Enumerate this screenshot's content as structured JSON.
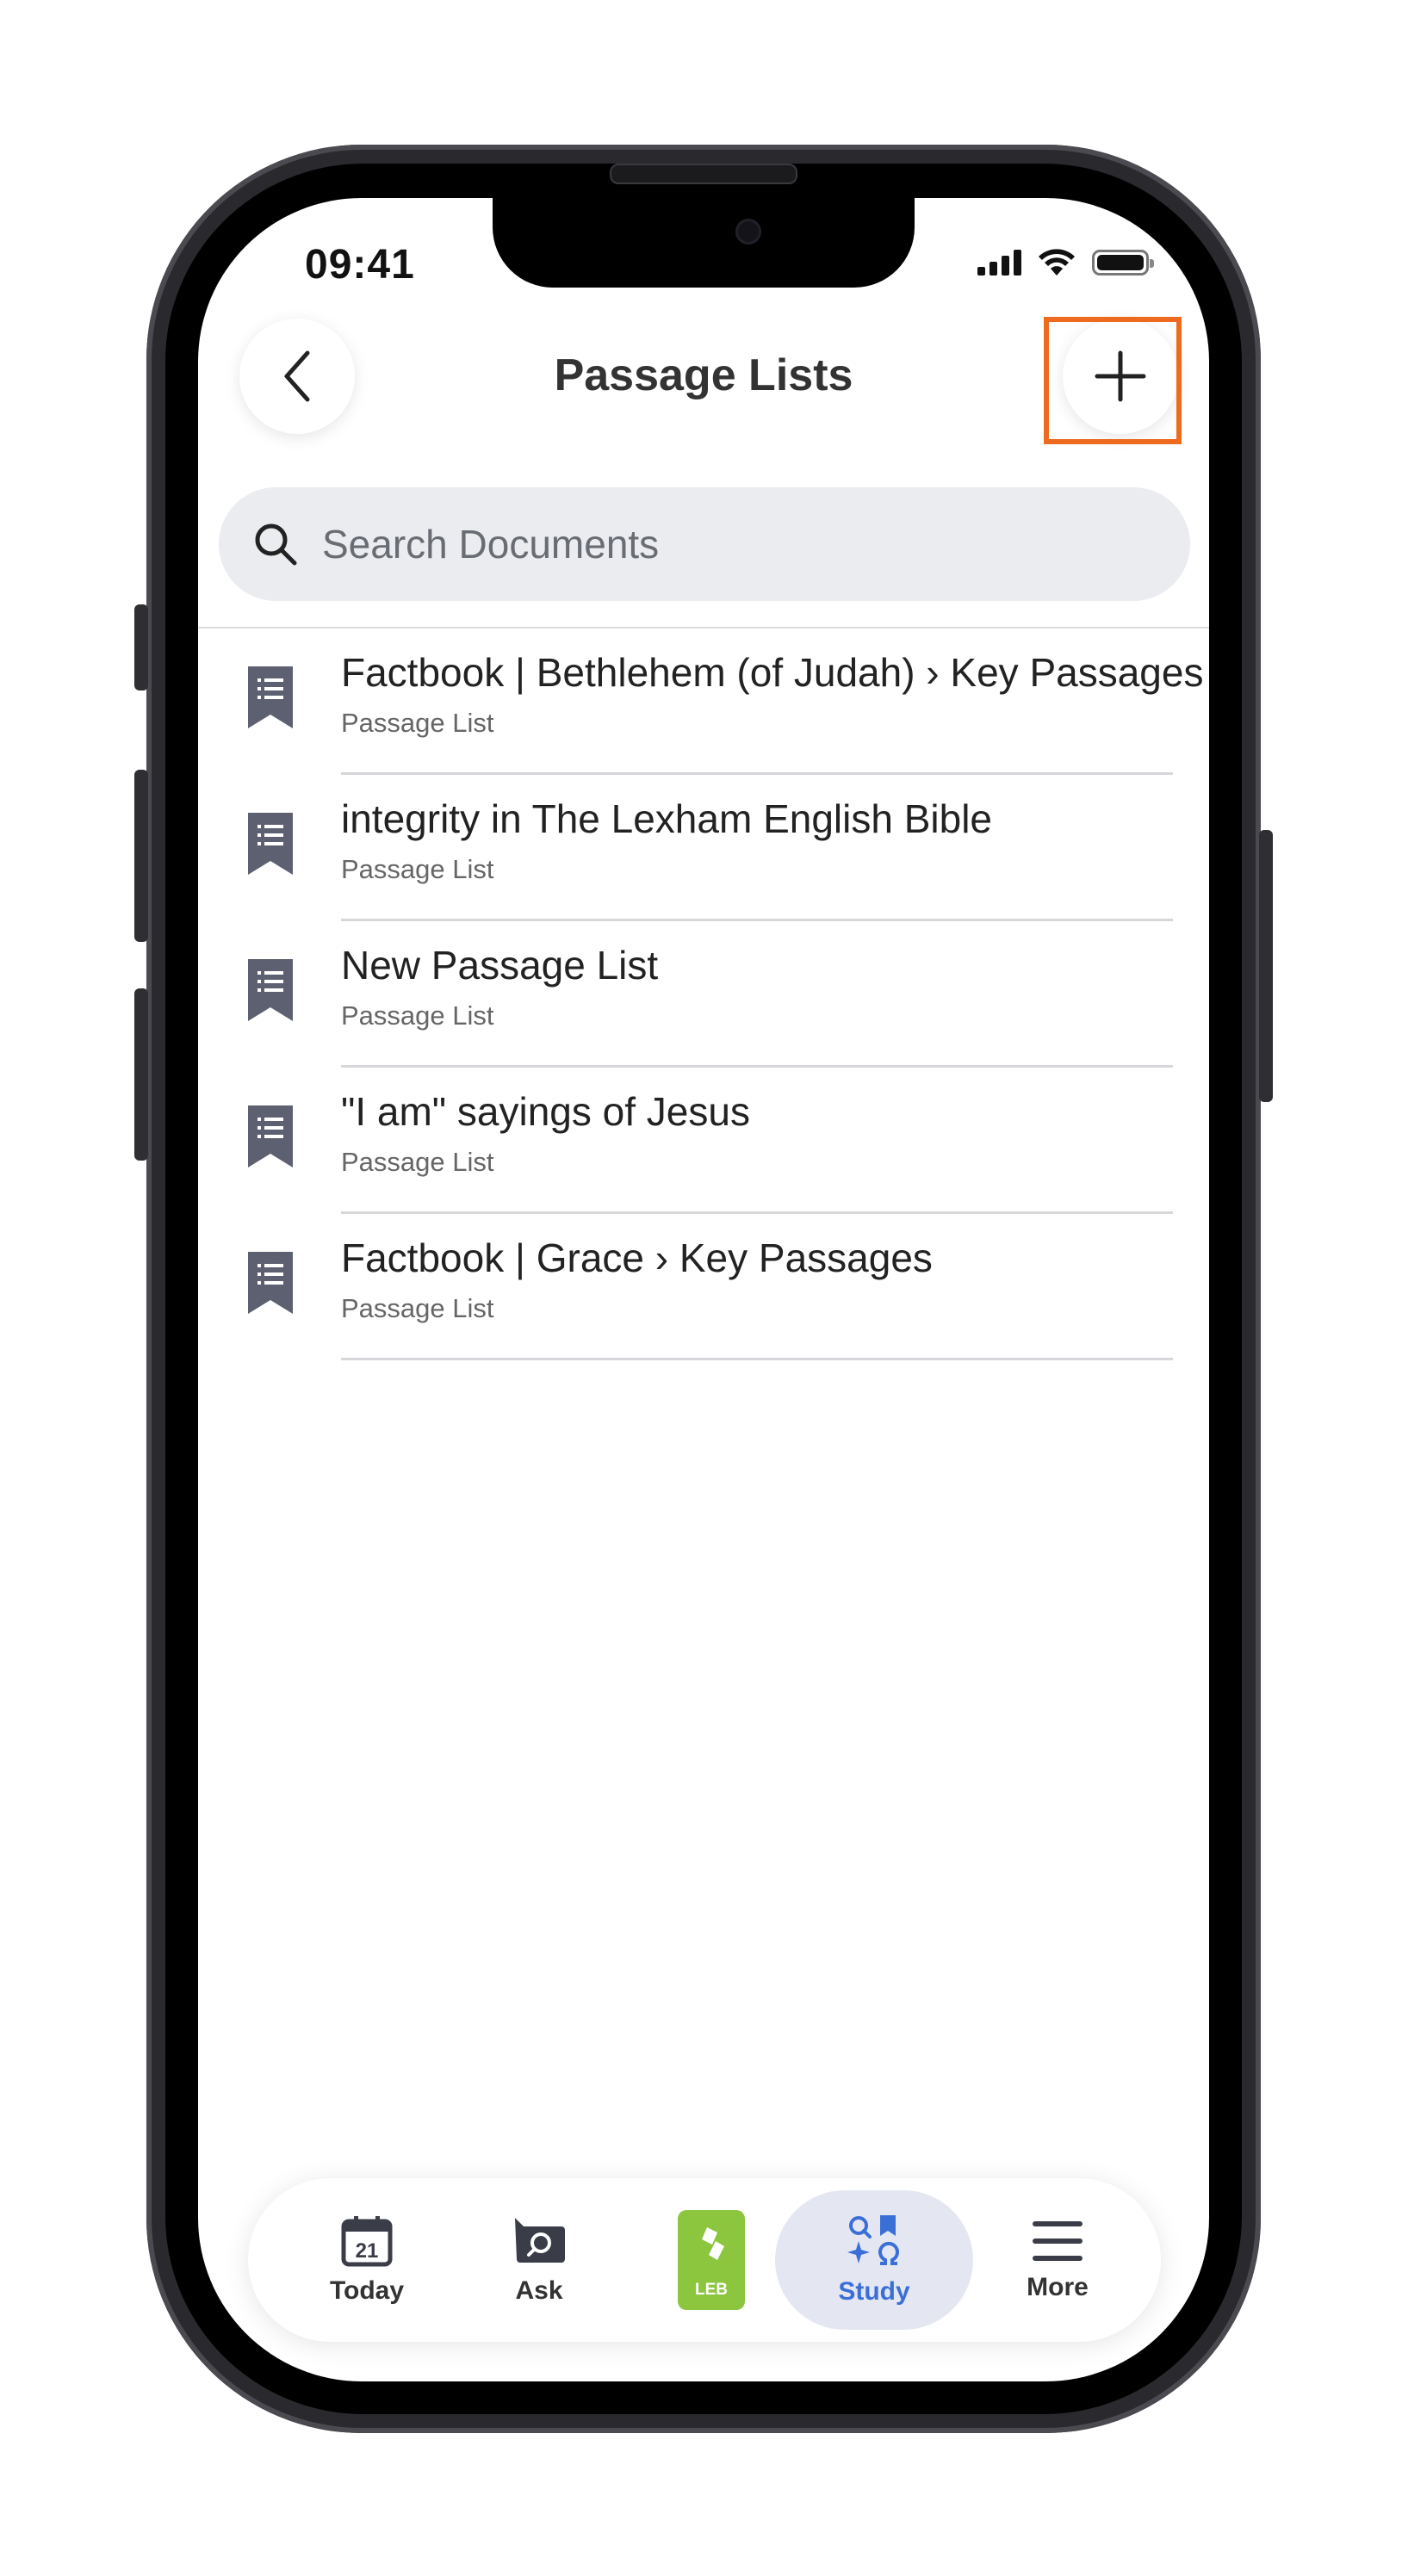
{
  "status_bar": {
    "time": "09:41"
  },
  "header": {
    "title": "Passage Lists",
    "back_icon": "chevron-left-icon",
    "add_icon": "plus-icon"
  },
  "search": {
    "placeholder": "Search Documents",
    "value": ""
  },
  "list": {
    "items": [
      {
        "title": "Factbook | Bethlehem (of Judah) › Key Passages",
        "subtitle": "Passage List"
      },
      {
        "title": "integrity in The Lexham English Bible",
        "subtitle": "Passage List"
      },
      {
        "title": "New Passage List",
        "subtitle": "Passage List"
      },
      {
        "title": "\"I am\" sayings of Jesus",
        "subtitle": "Passage List"
      },
      {
        "title": "Factbook | Grace › Key Passages",
        "subtitle": "Passage List"
      }
    ]
  },
  "tab_bar": {
    "today": {
      "label": "Today",
      "date_number": "21"
    },
    "ask": {
      "label": "Ask"
    },
    "leb": {
      "label": "LEB"
    },
    "study": {
      "label": "Study",
      "active": true
    },
    "more": {
      "label": "More"
    }
  },
  "colors": {
    "accent": "#3b6fd8",
    "highlight": "#ee6a1f",
    "leb_green": "#8cc63f",
    "icon_gray": "#5c6070"
  }
}
